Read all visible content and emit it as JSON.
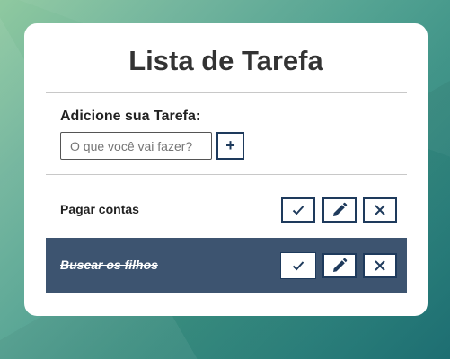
{
  "title": "Lista de Tarefa",
  "add_section": {
    "label": "Adicione sua Tarefa:",
    "input_placeholder": "O que você vai fazer?",
    "input_value": "",
    "add_button_label": "+"
  },
  "tasks": [
    {
      "text": "Pagar contas",
      "done": false
    },
    {
      "text": "Buscar os filhos",
      "done": true
    }
  ],
  "icons": {
    "done": "check-icon",
    "edit": "pencil-icon",
    "delete": "close-icon"
  },
  "colors": {
    "accent": "#1e3a5c",
    "done_row_bg": "#3d5470"
  }
}
